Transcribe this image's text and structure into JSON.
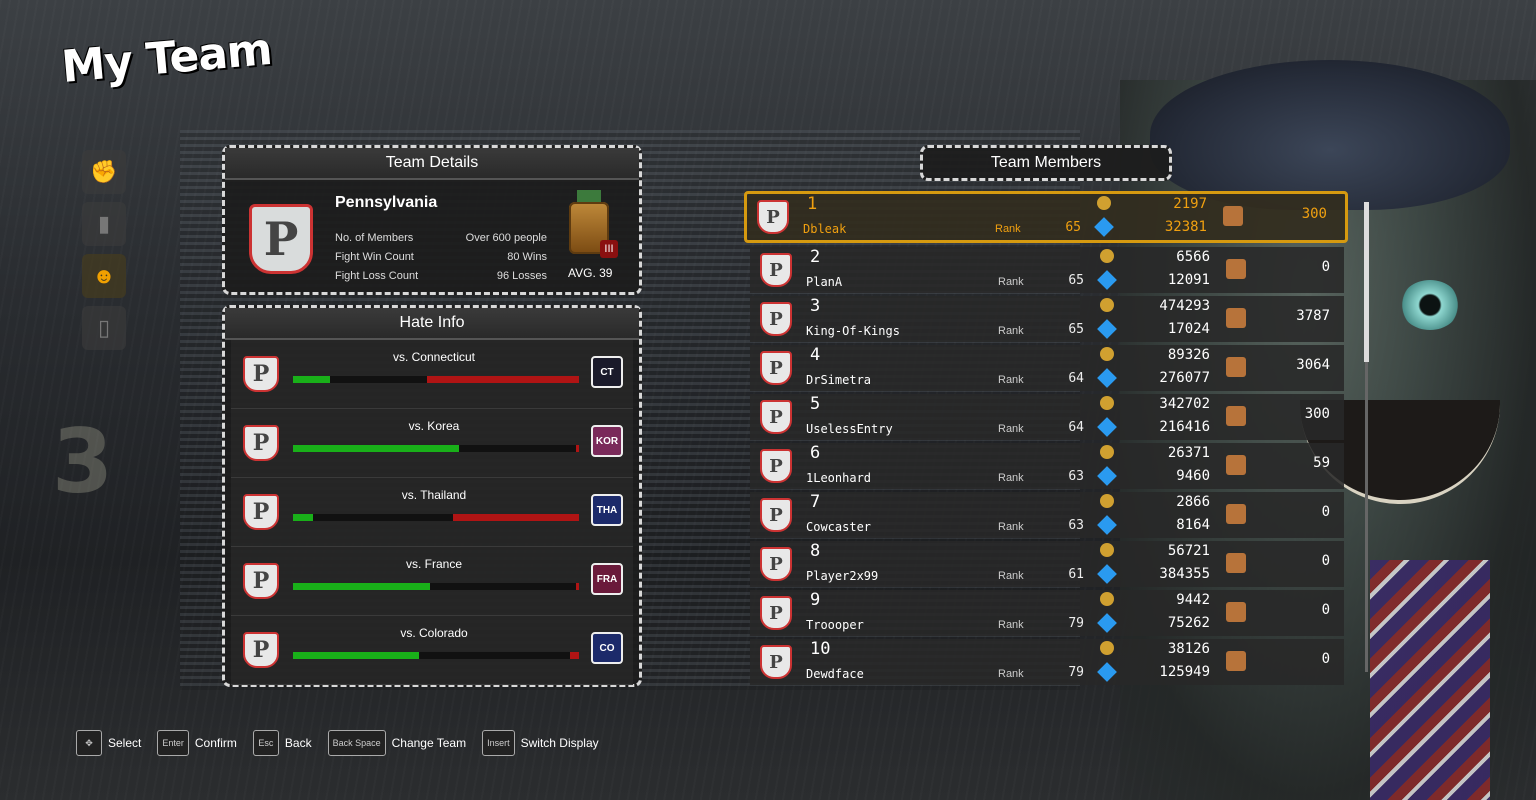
{
  "title": "My Team",
  "team_details": {
    "header": "Team Details",
    "name": "Pennsylvania",
    "members_label": "No. of Members",
    "members_value": "Over 600 people",
    "wins_label": "Fight Win Count",
    "wins_value": "80 Wins",
    "losses_label": "Fight Loss Count",
    "losses_value": "96 Losses",
    "medal_rank": "III",
    "avg": "AVG. 39"
  },
  "hate_info": {
    "header": "Hate Info",
    "rows": [
      {
        "label": "vs. Connecticut",
        "logo": "CT",
        "logo_color": "#1a1a2a",
        "green": 0.13,
        "red": 0.53
      },
      {
        "label": "vs. Korea",
        "logo": "KOR",
        "logo_color": "#7a2a5a",
        "green": 0.58,
        "red": 0.01
      },
      {
        "label": "vs. Thailand",
        "logo": "THA",
        "logo_color": "#1c2a6a",
        "green": 0.07,
        "red": 0.44
      },
      {
        "label": "vs. France",
        "logo": "FRA",
        "logo_color": "#6a1a3a",
        "green": 0.48,
        "red": 0.01
      },
      {
        "label": "vs. Colorado",
        "logo": "CO",
        "logo_color": "#1c2a6a",
        "green": 0.44,
        "red": 0.03
      }
    ]
  },
  "team_members": {
    "header": "Team Members",
    "rank_label": "Rank",
    "members": [
      {
        "pos": "1",
        "name": "Dbleak",
        "level": "65",
        "coins": "2197",
        "gems": "32381",
        "score": "300"
      },
      {
        "pos": "2",
        "name": "PlanA",
        "level": "65",
        "coins": "6566",
        "gems": "12091",
        "score": "0"
      },
      {
        "pos": "3",
        "name": "King-Of-Kings",
        "level": "65",
        "coins": "474293",
        "gems": "17024",
        "score": "3787"
      },
      {
        "pos": "4",
        "name": "DrSimetra",
        "level": "64",
        "coins": "89326",
        "gems": "276077",
        "score": "3064"
      },
      {
        "pos": "5",
        "name": "UselessEntry",
        "level": "64",
        "coins": "342702",
        "gems": "216416",
        "score": "300"
      },
      {
        "pos": "6",
        "name": "1Leonhard",
        "level": "63",
        "coins": "26371",
        "gems": "9460",
        "score": "59"
      },
      {
        "pos": "7",
        "name": "Cowcaster",
        "level": "63",
        "coins": "2866",
        "gems": "8164",
        "score": "0"
      },
      {
        "pos": "8",
        "name": "Player2x99",
        "level": "61",
        "coins": "56721",
        "gems": "384355",
        "score": "0"
      },
      {
        "pos": "9",
        "name": "Troooper",
        "level": "79",
        "coins": "9442",
        "gems": "75262",
        "score": "0"
      },
      {
        "pos": "10",
        "name": "Dewdface",
        "level": "79",
        "coins": "38126",
        "gems": "125949",
        "score": "0"
      }
    ]
  },
  "controls": [
    {
      "key": "✥",
      "label": "Select"
    },
    {
      "key": "Enter",
      "label": "Confirm"
    },
    {
      "key": "Esc",
      "label": "Back"
    },
    {
      "key": "Back Space",
      "label": "Change Team"
    },
    {
      "key": "Insert",
      "label": "Switch Display"
    }
  ],
  "colors": {
    "accent": "#d69a10",
    "win_bar": "#19b019",
    "loss_bar": "#b01414"
  }
}
